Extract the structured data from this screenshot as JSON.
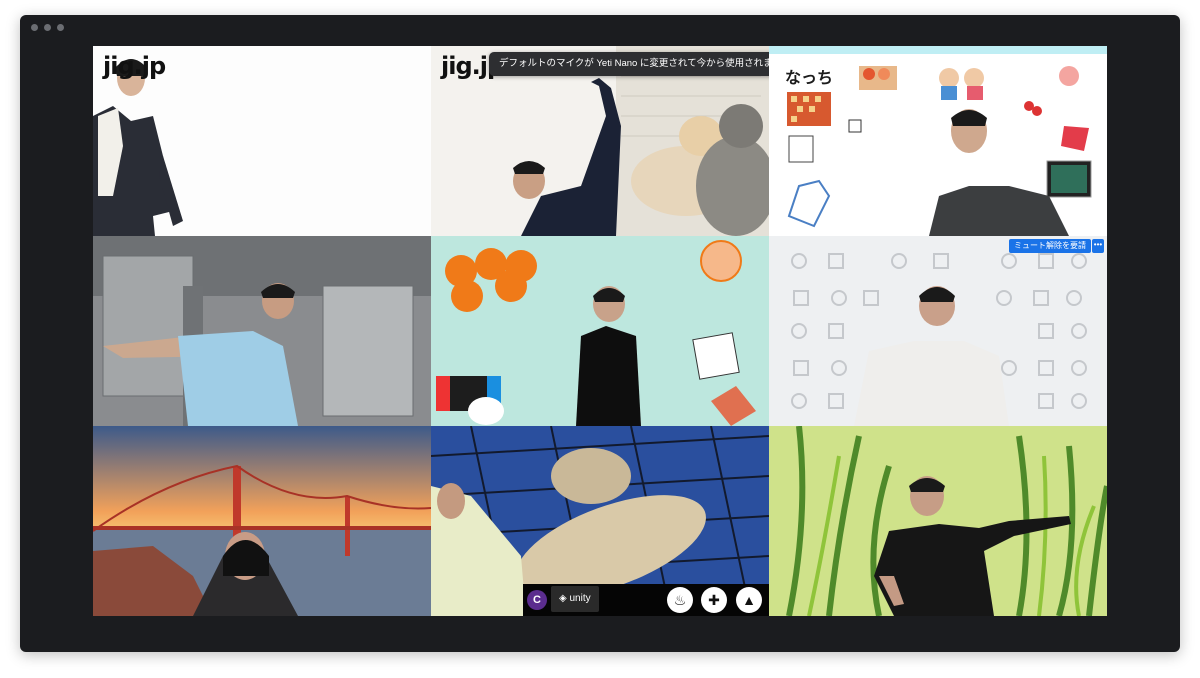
{
  "window": {
    "controls": [
      "dot",
      "dot",
      "dot"
    ]
  },
  "tiles": [
    {
      "name": "participant-tile-1",
      "logo": "jig.jp"
    },
    {
      "name": "participant-tile-2",
      "logo": "jig.jp",
      "active": true,
      "notification": "デフォルトのマイクが Yeti Nano に変更されて今から使用されます。"
    },
    {
      "name": "participant-tile-3",
      "label": "なっち"
    },
    {
      "name": "participant-tile-4"
    },
    {
      "name": "participant-tile-5"
    },
    {
      "name": "participant-tile-6",
      "unmute_request_label": "ミュート解除を要請",
      "more_label": "•••"
    },
    {
      "name": "participant-tile-7"
    },
    {
      "name": "participant-tile-8",
      "badge_text": "C",
      "unity_label": "unity",
      "bottom_icons": [
        "grill-icon",
        "gamepad-icon",
        "shuttlecock-icon"
      ]
    },
    {
      "name": "participant-tile-9"
    }
  ],
  "colors": {
    "active_border": "#34a853",
    "accent": "#1a73e8",
    "background": "#1b1c1f"
  }
}
